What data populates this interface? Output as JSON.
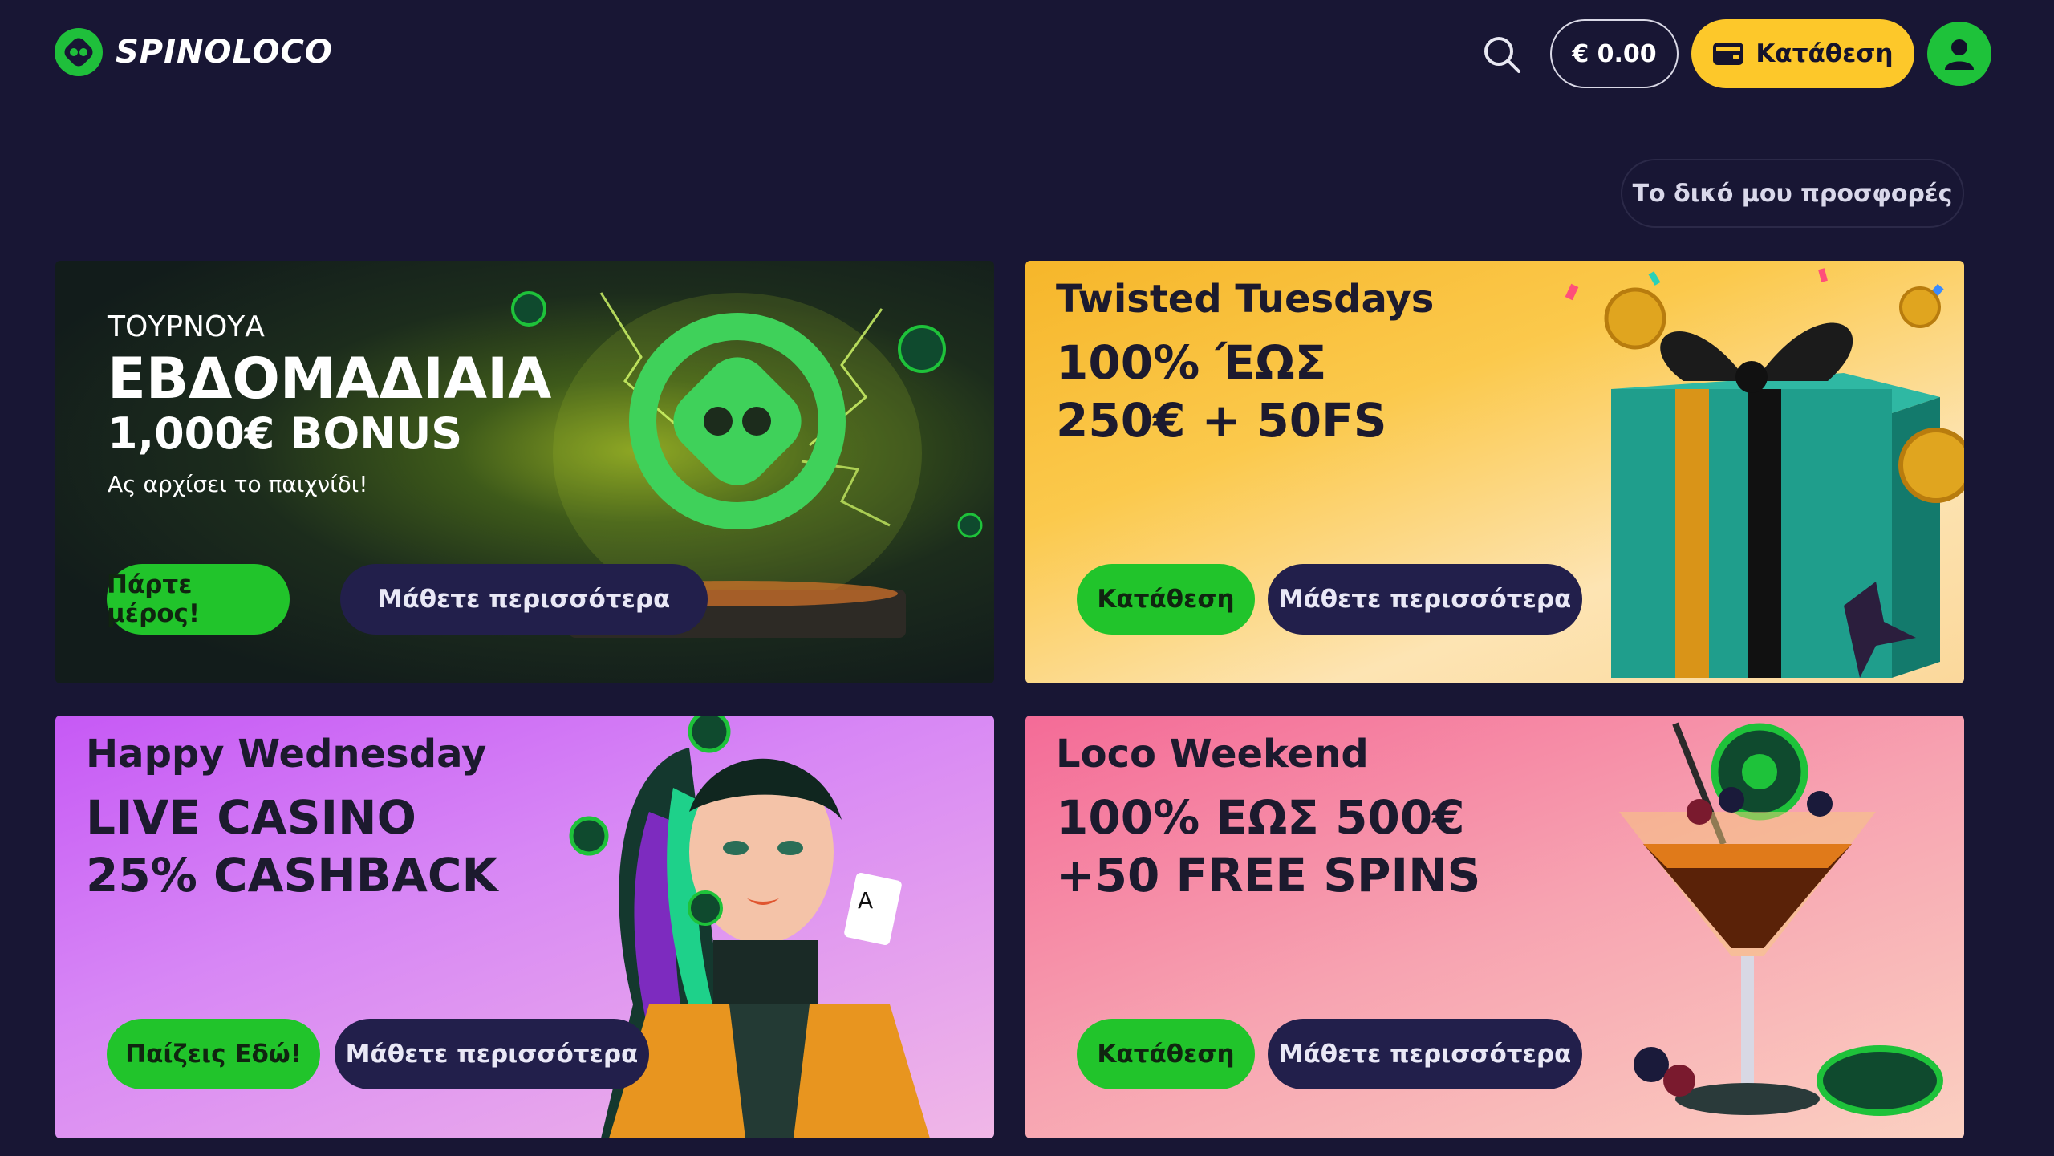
{
  "brand": {
    "name": "SPINOLOCO"
  },
  "header": {
    "balance": "€ 0.00",
    "deposit_label": "Κατάθεση"
  },
  "my_offers_label": "Το δικό μου προσφορές",
  "cards": [
    {
      "eyebrow": "ΤΟΥΡΝΟΥΑ",
      "title": "ΕΒΔΟΜΑΔΙΑΙΑ",
      "subtitle": "1,000€ BONUS",
      "tagline": "Ας αρχίσει το παιχνίδι!",
      "primary_label": "Πάρτε μέρος!",
      "secondary_label": "Μάθετε περισσότερα"
    },
    {
      "eyebrow": "Twisted Tuesdays",
      "line1": "100% ΈΩΣ",
      "line2": "250€ + 50FS",
      "primary_label": "Κατάθεση",
      "secondary_label": "Μάθετε περισσότερα"
    },
    {
      "eyebrow": "Happy Wednesday",
      "line1": "LIVE CASINO",
      "line2": "25% CASHBACK",
      "primary_label": "Παίζεις Εδώ!",
      "secondary_label": "Μάθετε περισσότερα"
    },
    {
      "eyebrow": "Loco Weekend",
      "line1": "100% ΕΩΣ 500€",
      "line2": "+50 FREE SPINS",
      "primary_label": "Κατάθεση",
      "secondary_label": "Μάθετε περισσότερα"
    }
  ],
  "colors": {
    "background": "#181634",
    "accent_green": "#21c42b",
    "accent_yellow": "#fdc82a",
    "button_dark": "#221f4b"
  }
}
